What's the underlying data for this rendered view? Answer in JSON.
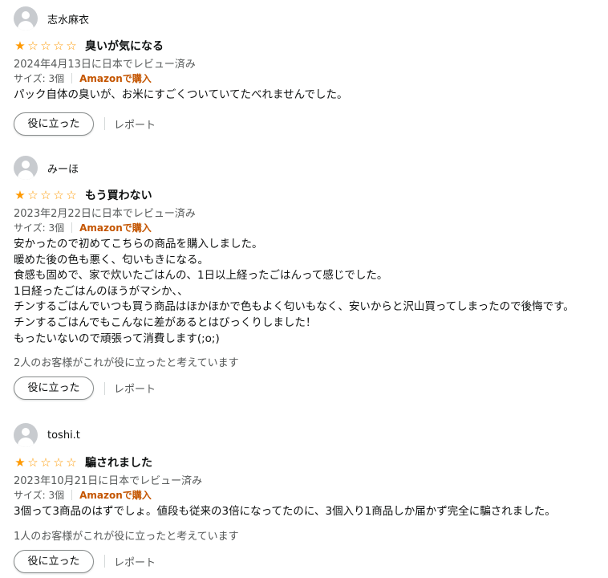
{
  "reviews": [
    {
      "name": "志水麻衣",
      "rating": 1,
      "title": "臭いが気になる",
      "date": "2024年4月13日に日本でレビュー済み",
      "size": "サイズ: 3個",
      "verified": "Amazonで購入",
      "body": [
        "パック自体の臭いが、お米にすごくついていてたべれませんでした。"
      ],
      "helpful_count": "",
      "helpful_button": "役に立った",
      "report": "レポート"
    },
    {
      "name": "みーほ",
      "rating": 1,
      "title": "もう買わない",
      "date": "2023年2月22日に日本でレビュー済み",
      "size": "サイズ: 3個",
      "verified": "Amazonで購入",
      "body": [
        "安かったので初めてこちらの商品を購入しました。",
        "暖めた後の色も悪く、匂いもきになる。",
        "食感も固めで、家で炊いたごはんの、1日以上経ったごはんって感じでした。",
        "1日経ったごはんのほうがマシか、、",
        "チンするごはんでいつも買う商品はほかほかで色もよく匂いもなく、安いからと沢山買ってしまったので後悔です。",
        "チンするごはんでもこんなに差があるとはびっくりしました！",
        "もったいないので頑張って消費します(;o;)"
      ],
      "helpful_count": "2人のお客様がこれが役に立ったと考えています",
      "helpful_button": "役に立った",
      "report": "レポート"
    },
    {
      "name": "toshi.t",
      "rating": 1,
      "title": "騙されました",
      "date": "2023年10月21日に日本でレビュー済み",
      "size": "サイズ: 3個",
      "verified": "Amazonで購入",
      "body": [
        "3個って3商品のはずでしょ。値段も従来の3倍になってたのに、3個入り1商品しか届かず完全に騙されました。"
      ],
      "helpful_count": "1人のお客様がこれが役に立ったと考えています",
      "helpful_button": "役に立った",
      "report": "レポート"
    }
  ],
  "colors": {
    "star": "#ff9900",
    "verified": "#c45500",
    "muted": "#565959"
  },
  "icons": {
    "avatar": "default-avatar-icon",
    "star_full": "star-filled-icon",
    "star_empty": "star-outline-icon"
  }
}
